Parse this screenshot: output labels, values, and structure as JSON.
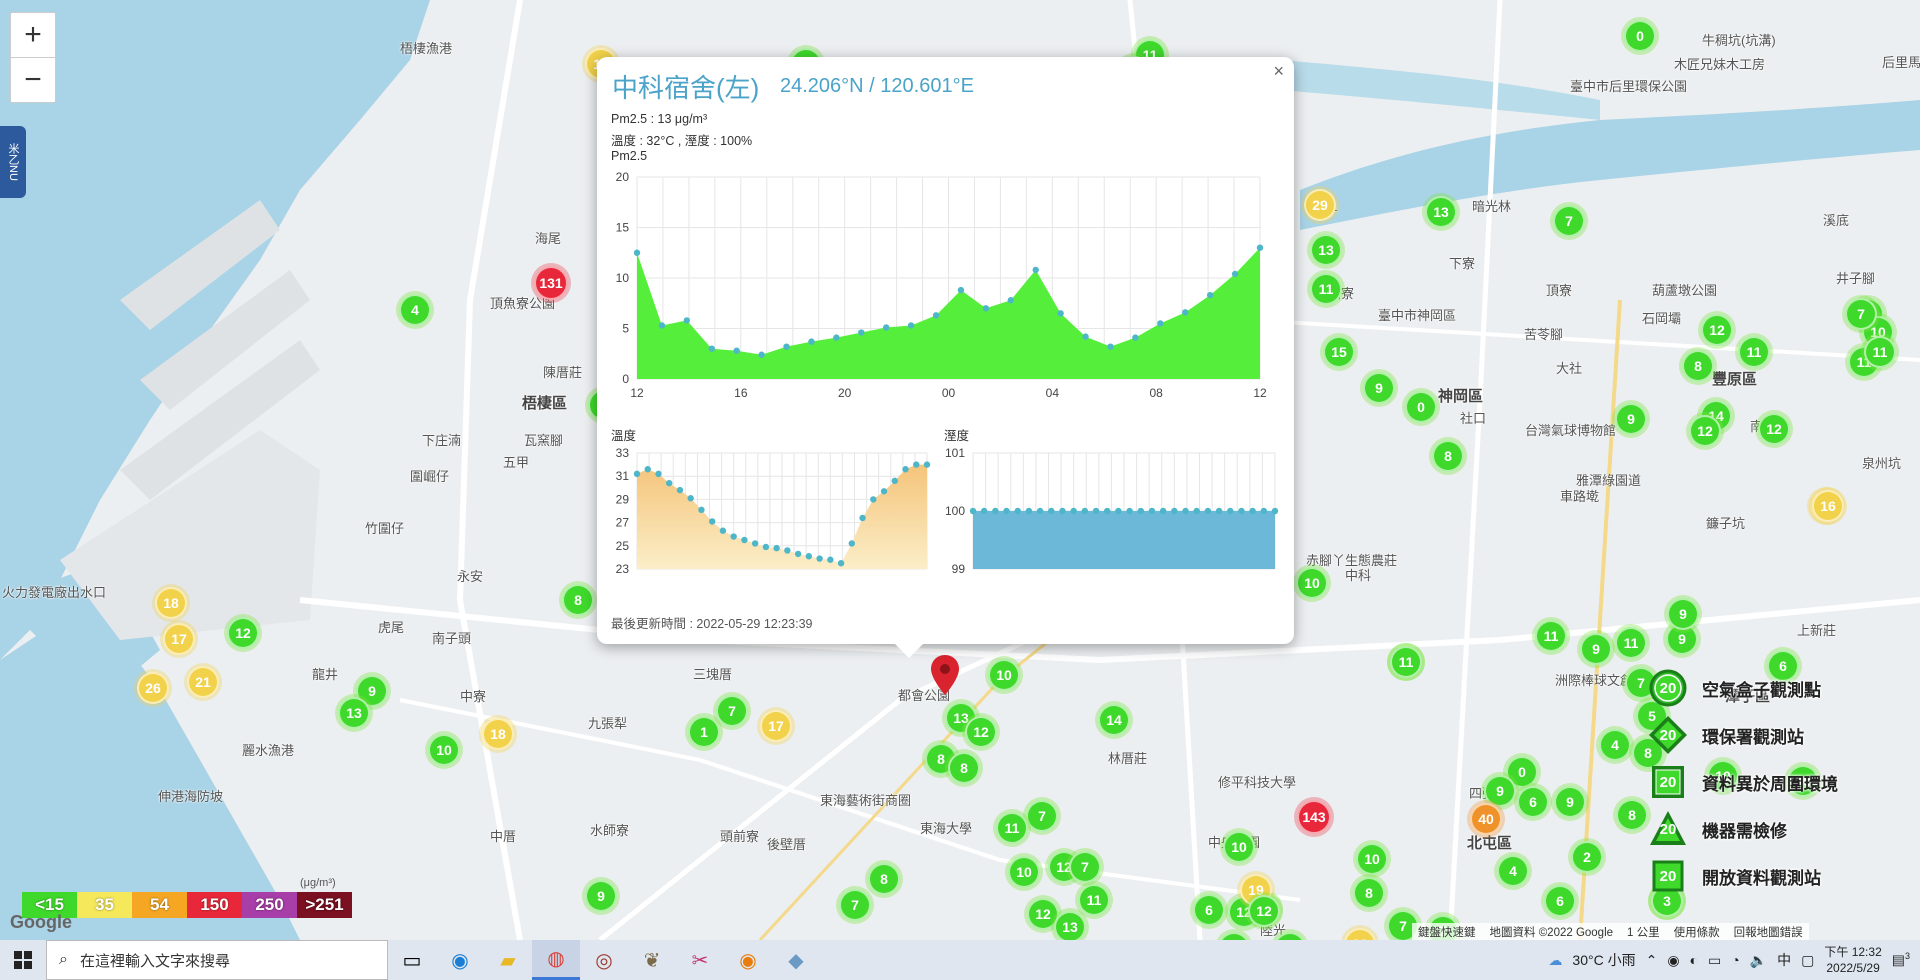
{
  "map": {
    "zoom_in": "+",
    "zoom_out": "−",
    "side_tab": "米乙NU",
    "labels": [
      {
        "text": "梧棲漁港",
        "cls": ""
      },
      {
        "text": "海尾",
        "cls": ""
      },
      {
        "text": "頂魚寮公園",
        "cls": ""
      },
      {
        "text": "陳厝莊",
        "cls": ""
      },
      {
        "text": "梧棲區",
        "cls": "district"
      },
      {
        "text": "下庄湳",
        "cls": ""
      },
      {
        "text": "瓦窯腳",
        "cls": ""
      },
      {
        "text": "圍崛仔",
        "cls": ""
      },
      {
        "text": "五甲",
        "cls": ""
      },
      {
        "text": "竹圍仔",
        "cls": ""
      },
      {
        "text": "永安",
        "cls": ""
      },
      {
        "text": "虎尾",
        "cls": ""
      },
      {
        "text": "南子頭",
        "cls": ""
      },
      {
        "text": "龍井",
        "cls": ""
      },
      {
        "text": "中寮",
        "cls": ""
      },
      {
        "text": "麗水漁港",
        "cls": ""
      },
      {
        "text": "火力發電廠出水口",
        "cls": ""
      },
      {
        "text": "三塊厝",
        "cls": ""
      },
      {
        "text": "九張犁",
        "cls": ""
      },
      {
        "text": "都會公園",
        "cls": ""
      },
      {
        "text": "伸港海防坡",
        "cls": ""
      },
      {
        "text": "中厝",
        "cls": ""
      },
      {
        "text": "水師寮",
        "cls": ""
      },
      {
        "text": "頭前寮",
        "cls": ""
      },
      {
        "text": "後壁厝",
        "cls": ""
      },
      {
        "text": "東海藝術街商圈",
        "cls": ""
      },
      {
        "text": "東海大學",
        "cls": ""
      },
      {
        "text": "林厝莊",
        "cls": ""
      },
      {
        "text": "中央公園",
        "cls": ""
      },
      {
        "text": "神岡區",
        "cls": "district"
      },
      {
        "text": "豐原區",
        "cls": "district"
      },
      {
        "text": "南陽路",
        "cls": ""
      },
      {
        "text": "社口",
        "cls": ""
      },
      {
        "text": "大社",
        "cls": ""
      },
      {
        "text": "頂寮",
        "cls": ""
      },
      {
        "text": "苦苓腳",
        "cls": ""
      },
      {
        "text": "車路墘",
        "cls": ""
      },
      {
        "text": "潭子區",
        "cls": "district"
      },
      {
        "text": "北屯區",
        "cls": "district"
      },
      {
        "text": "洲際棒球文創園區",
        "cls": ""
      },
      {
        "text": "四張犁",
        "cls": ""
      },
      {
        "text": "上新莊",
        "cls": ""
      },
      {
        "text": "后里馬場",
        "cls": ""
      },
      {
        "text": "臺中市后里環保公園",
        "cls": ""
      },
      {
        "text": "牛稠坑(坑溝)",
        "cls": ""
      },
      {
        "text": "木匠兄妹木工房",
        "cls": ""
      },
      {
        "text": "葫蘆墩公園",
        "cls": ""
      },
      {
        "text": "石岡壩",
        "cls": ""
      },
      {
        "text": "井子腳",
        "cls": ""
      },
      {
        "text": "泉州坑",
        "cls": ""
      },
      {
        "text": "鐮子坑",
        "cls": ""
      },
      {
        "text": "台灣氣球博物館",
        "cls": ""
      },
      {
        "text": "雅潭綠園道",
        "cls": ""
      },
      {
        "text": "赤腳丫生態農莊",
        "cls": ""
      },
      {
        "text": "廍子",
        "cls": ""
      },
      {
        "text": "溪底",
        "cls": ""
      },
      {
        "text": "暗光林",
        "cls": ""
      },
      {
        "text": "下寮",
        "cls": ""
      },
      {
        "text": "田寮",
        "cls": ""
      },
      {
        "text": "臺中市神岡區",
        "cls": ""
      },
      {
        "text": "中科",
        "cls": ""
      },
      {
        "text": "修平科技大學",
        "cls": ""
      },
      {
        "text": "陸光",
        "cls": ""
      }
    ],
    "markers": [
      {
        "v": "16",
        "c": "yellow"
      },
      {
        "v": "5",
        "c": "green"
      },
      {
        "v": "11",
        "c": "green"
      },
      {
        "v": "11",
        "c": "green"
      },
      {
        "v": "0",
        "c": "green"
      },
      {
        "v": "131",
        "c": "red"
      },
      {
        "v": "4",
        "c": "green"
      },
      {
        "v": "8",
        "c": "green"
      },
      {
        "v": "29",
        "c": "yellow"
      },
      {
        "v": "13",
        "c": "green"
      },
      {
        "v": "7",
        "c": "green"
      },
      {
        "v": "13",
        "c": "green"
      },
      {
        "v": "11",
        "c": "green"
      },
      {
        "v": "15",
        "c": "green"
      },
      {
        "v": "9",
        "c": "green"
      },
      {
        "v": "0",
        "c": "green"
      },
      {
        "v": "8",
        "c": "green"
      },
      {
        "v": "9",
        "c": "green"
      },
      {
        "v": "12",
        "c": "green"
      },
      {
        "v": "11",
        "c": "green"
      },
      {
        "v": "8",
        "c": "green"
      },
      {
        "v": "14",
        "c": "green"
      },
      {
        "v": "12",
        "c": "green"
      },
      {
        "v": "12",
        "c": "green"
      },
      {
        "v": "7",
        "c": "green"
      },
      {
        "v": "10",
        "c": "green"
      },
      {
        "v": "11",
        "c": "green"
      },
      {
        "v": "16",
        "c": "yellow"
      },
      {
        "v": "18",
        "c": "yellow"
      },
      {
        "v": "17",
        "c": "yellow"
      },
      {
        "v": "26",
        "c": "yellow"
      },
      {
        "v": "21",
        "c": "yellow"
      },
      {
        "v": "12",
        "c": "green"
      },
      {
        "v": "9",
        "c": "green"
      },
      {
        "v": "13",
        "c": "green"
      },
      {
        "v": "8",
        "c": "green"
      },
      {
        "v": "10",
        "c": "green"
      },
      {
        "v": "15",
        "c": "green"
      },
      {
        "v": "18",
        "c": "yellow"
      },
      {
        "v": "9",
        "c": "green"
      },
      {
        "v": "10",
        "c": "green"
      },
      {
        "v": "1",
        "c": "green"
      },
      {
        "v": "7",
        "c": "green"
      },
      {
        "v": "17",
        "c": "yellow"
      },
      {
        "v": "13",
        "c": "green"
      },
      {
        "v": "12",
        "c": "green"
      },
      {
        "v": "8",
        "c": "green"
      },
      {
        "v": "8",
        "c": "green"
      },
      {
        "v": "10",
        "c": "green"
      },
      {
        "v": "14",
        "c": "green"
      },
      {
        "v": "7",
        "c": "green"
      },
      {
        "v": "11",
        "c": "green"
      },
      {
        "v": "10",
        "c": "green"
      },
      {
        "v": "12",
        "c": "green"
      },
      {
        "v": "12",
        "c": "green"
      },
      {
        "v": "7",
        "c": "green"
      },
      {
        "v": "11",
        "c": "green"
      },
      {
        "v": "13",
        "c": "green"
      },
      {
        "v": "8",
        "c": "green"
      },
      {
        "v": "7",
        "c": "green"
      },
      {
        "v": "10",
        "c": "green"
      },
      {
        "v": "143",
        "c": "red"
      },
      {
        "v": "10",
        "c": "green"
      },
      {
        "v": "12",
        "c": "green"
      },
      {
        "v": "11",
        "c": "green"
      },
      {
        "v": "11",
        "c": "green"
      },
      {
        "v": "9",
        "c": "green"
      },
      {
        "v": "9",
        "c": "green"
      },
      {
        "v": "11",
        "c": "green"
      },
      {
        "v": "9",
        "c": "green"
      },
      {
        "v": "7",
        "c": "green"
      },
      {
        "v": "5",
        "c": "green"
      },
      {
        "v": "4",
        "c": "green"
      },
      {
        "v": "8",
        "c": "green"
      },
      {
        "v": "0",
        "c": "green"
      },
      {
        "v": "9",
        "c": "green"
      },
      {
        "v": "6",
        "c": "green"
      },
      {
        "v": "9",
        "c": "green"
      },
      {
        "v": "40",
        "c": "orange"
      },
      {
        "v": "8",
        "c": "green"
      },
      {
        "v": "2",
        "c": "green"
      },
      {
        "v": "4",
        "c": "green"
      },
      {
        "v": "6",
        "c": "green"
      },
      {
        "v": "6",
        "c": "green"
      },
      {
        "v": "10",
        "c": "green"
      },
      {
        "v": "10",
        "c": "green"
      },
      {
        "v": "8",
        "c": "green"
      },
      {
        "v": "19",
        "c": "yellow"
      },
      {
        "v": "12",
        "c": "green"
      },
      {
        "v": "6",
        "c": "green"
      },
      {
        "v": "7",
        "c": "green"
      },
      {
        "v": "7",
        "c": "green"
      },
      {
        "v": "20",
        "c": "yellow"
      },
      {
        "v": "12",
        "c": "green"
      },
      {
        "v": "9",
        "c": "green"
      },
      {
        "v": "16",
        "c": "yellow"
      },
      {
        "v": "11",
        "c": "green"
      },
      {
        "v": "7",
        "c": "green"
      },
      {
        "v": "10",
        "c": "green"
      },
      {
        "v": "6",
        "c": "green"
      },
      {
        "v": "3",
        "c": "green"
      }
    ]
  },
  "popup": {
    "title": "中科宿舍(左)",
    "coords": "24.206°N / 120.601°E",
    "pm25_line": "Pm2.5 : 13 μg/m³",
    "temp_humid_line": "溫度 : 32°C , 溼度 : 100%",
    "pm25_label": "Pm2.5",
    "temp_label": "溫度",
    "humid_label": "溼度",
    "updated": "最後更新時間 : 2022-05-29 12:23:39",
    "close": "×"
  },
  "chart_data": [
    {
      "type": "area",
      "title": "Pm2.5",
      "x_ticks": [
        "12",
        "16",
        "20",
        "00",
        "04",
        "08",
        "12"
      ],
      "ylim": [
        0,
        20
      ],
      "y_ticks": [
        0,
        5,
        10,
        15,
        20
      ],
      "values": [
        12.5,
        5.3,
        5.8,
        3.0,
        2.8,
        2.4,
        3.2,
        3.7,
        4.1,
        4.6,
        5.1,
        5.3,
        6.3,
        8.8,
        7.0,
        7.8,
        10.8,
        6.5,
        4.2,
        3.2,
        4.1,
        5.5,
        6.6,
        8.3,
        10.4,
        13.0
      ],
      "color": "#55ef3b"
    },
    {
      "type": "area",
      "title": "溫度",
      "ylim": [
        23,
        33
      ],
      "y_ticks": [
        23,
        25,
        27,
        29,
        31,
        33
      ],
      "values": [
        31.2,
        31.6,
        31.2,
        30.4,
        29.8,
        29.1,
        28.1,
        27.1,
        26.3,
        25.8,
        25.5,
        25.2,
        24.9,
        24.8,
        24.6,
        24.3,
        24.1,
        23.9,
        23.8,
        23.5,
        25.2,
        27.4,
        29.0,
        29.7,
        30.6,
        31.6,
        32.0,
        32.0
      ],
      "color": "#f5c47a"
    },
    {
      "type": "area",
      "title": "溼度",
      "ylim": [
        99,
        101
      ],
      "y_ticks": [
        99,
        100,
        101
      ],
      "values": [
        100,
        100,
        100,
        100,
        100,
        100,
        100,
        100,
        100,
        100,
        100,
        100,
        100,
        100,
        100,
        100,
        100,
        100,
        100,
        100,
        100,
        100,
        100,
        100,
        100,
        100,
        100,
        100
      ],
      "color": "#6cb8d8"
    }
  ],
  "legend": {
    "items": [
      {
        "label": "空氣盒子觀測點",
        "value": "20",
        "shape": "circle"
      },
      {
        "label": "環保署觀測站",
        "value": "20",
        "shape": "diamond"
      },
      {
        "label": "資料異於周圍環境",
        "value": "20",
        "shape": "square"
      },
      {
        "label": "機器需檢修",
        "value": "20",
        "shape": "triangle"
      },
      {
        "label": "開放資料觀測站",
        "value": "20",
        "shape": "square-plain"
      }
    ]
  },
  "aqi_scale": {
    "unit": "(μg/m³)",
    "levels": [
      {
        "label": "<15",
        "color": "#3fd92c"
      },
      {
        "label": "35",
        "color": "#f5e85a"
      },
      {
        "label": "54",
        "color": "#f5a623"
      },
      {
        "label": "150",
        "color": "#e8283a"
      },
      {
        "label": "250",
        "color": "#a83ea8"
      },
      {
        "label": ">251",
        "color": "#7a1020"
      }
    ]
  },
  "attribution": {
    "google": "Google",
    "shortcuts": "鍵盤快速鍵",
    "map_data": "地圖資料 ©2022 Google",
    "scale": "1 公里",
    "terms": "使用條款",
    "report": "回報地圖錯誤"
  },
  "taskbar": {
    "search_placeholder": "在這裡輸入文字來搜尋",
    "weather": "30°C 小雨",
    "ime": "中",
    "time": "下午 12:32",
    "date": "2022/5/29",
    "notification_count": "3"
  }
}
